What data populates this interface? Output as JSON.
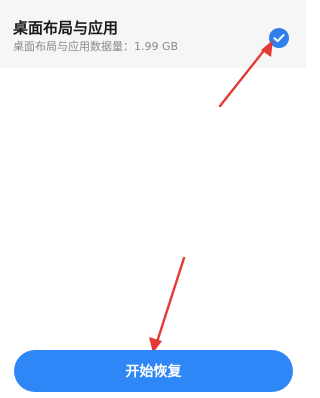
{
  "item": {
    "title": "桌面布局与应用",
    "subtitle": "桌面布局与应用数据量：1.99 GB",
    "checked": true,
    "check_icon": "checkmark-icon",
    "accent_color": "#2f80ed"
  },
  "actions": {
    "start_restore_label": "开始恢复",
    "button_color": "#2f86f6"
  },
  "annotations": {
    "arrow_color": "#e53935"
  }
}
